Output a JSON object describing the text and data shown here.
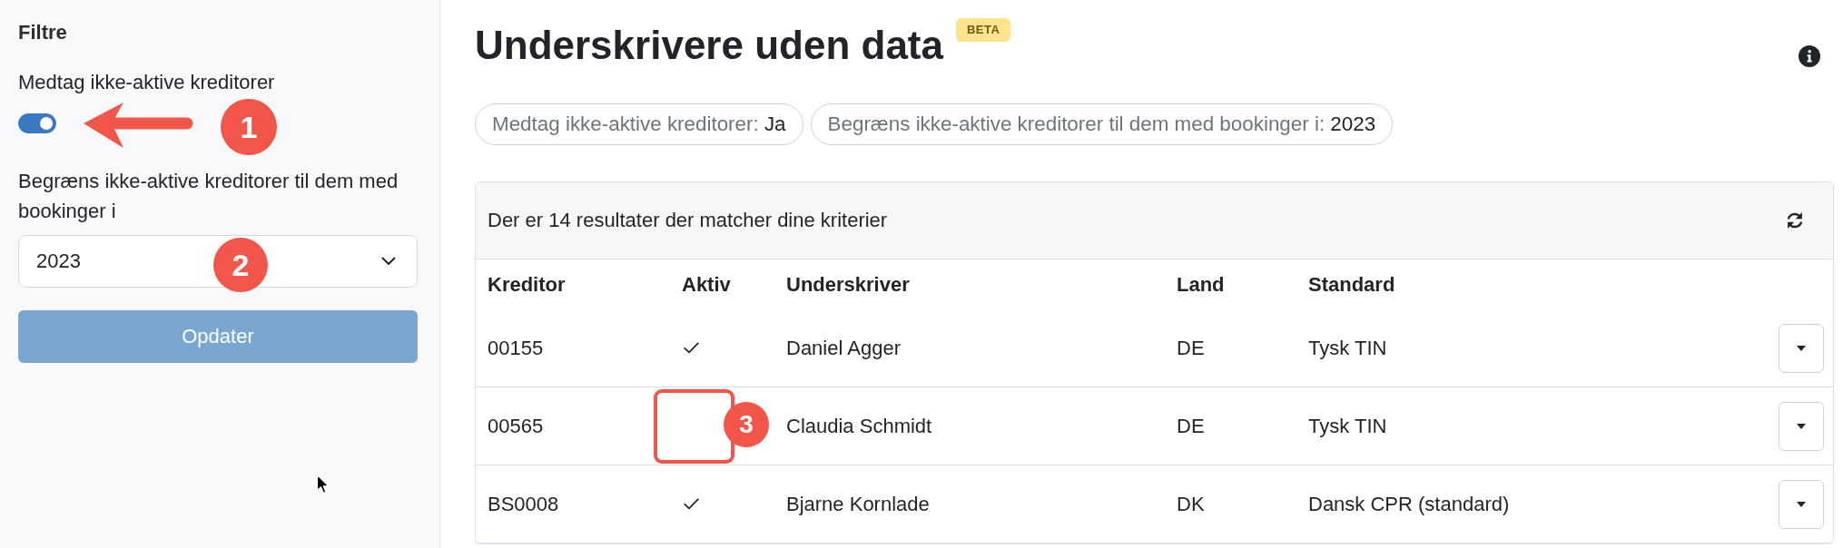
{
  "sidebar": {
    "title": "Filtre",
    "include_inactive": {
      "label": "Medtag ikke-aktive kreditorer",
      "on": true,
      "callout": {
        "label": "1",
        "kind": "arrow"
      }
    },
    "booking_year": {
      "label": "Begræns ikke-aktive kreditorer til dem med bookinger i",
      "value": "2023",
      "callout": {
        "label": "2",
        "kind": "badge"
      }
    },
    "update_button": {
      "label": "Opdater",
      "disabled": true
    }
  },
  "header": {
    "title": "Underskrivere uden data",
    "badge": "BETA"
  },
  "filter_chips": [
    {
      "label": "Medtag ikke-aktive kreditorer:",
      "value": "Ja"
    },
    {
      "label": "Begræns ikke-aktive kreditorer til dem med bookinger i:",
      "value": "2023"
    }
  ],
  "results": {
    "summary": "Der er 14 resultater der matcher dine kriterier",
    "columns": [
      "Kreditor",
      "Aktiv",
      "Underskriver",
      "Land",
      "Standard"
    ],
    "rows": [
      {
        "creditor": "00155",
        "active": true,
        "signer": "Daniel Agger",
        "country": "DE",
        "standard": "Tysk TIN"
      },
      {
        "creditor": "00565",
        "active": false,
        "signer": "Claudia Schmidt",
        "country": "DE",
        "standard": "Tysk TIN",
        "callout": {
          "label": "3",
          "kind": "box"
        }
      },
      {
        "creditor": "BS0008",
        "active": true,
        "signer": "Bjarne Kornlade",
        "country": "DK",
        "standard": "Dansk CPR (standard)"
      }
    ]
  }
}
